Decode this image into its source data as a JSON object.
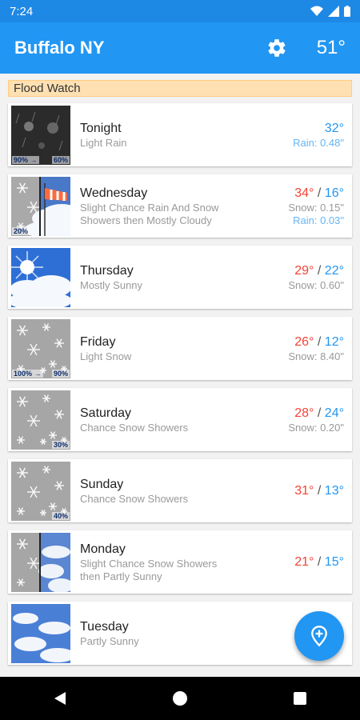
{
  "status_bar": {
    "time": "7:24"
  },
  "app_bar": {
    "title": "Buffalo NY",
    "current_temp": "51°",
    "settings_icon": "gear-icon"
  },
  "alert": {
    "label": "Flood Watch"
  },
  "forecast": [
    {
      "day": "Tonight",
      "desc": "Light Rain",
      "desc2": "",
      "hi": "",
      "lo": "32°",
      "precip1": "Rain: 0.48\"",
      "precip1_type": "rain",
      "precip2": "",
      "precip2_type": "",
      "pct_left": "90%",
      "pct_arrow": "→",
      "pct_right": "60%",
      "image": "night-rain"
    },
    {
      "day": "Wednesday",
      "desc": "Slight Chance Rain And Snow",
      "desc2": "Showers then Mostly Cloudy",
      "hi": "34°",
      "lo": "16°",
      "precip1": "Snow: 0.15\"",
      "precip1_type": "snow",
      "precip2": "Rain: 0.03\"",
      "precip2_type": "rain",
      "pct_left": "20%",
      "pct_arrow": "",
      "pct_right": "",
      "image": "snow-windy"
    },
    {
      "day": "Thursday",
      "desc": "Mostly Sunny",
      "desc2": "",
      "hi": "29°",
      "lo": "22°",
      "precip1": "Snow: 0.60\"",
      "precip1_type": "snow",
      "precip2": "",
      "precip2_type": "",
      "pct_left": "",
      "pct_arrow": "",
      "pct_right": "",
      "image": "sunny"
    },
    {
      "day": "Friday",
      "desc": "Light Snow",
      "desc2": "",
      "hi": "26°",
      "lo": "12°",
      "precip1": "Snow: 8.40\"",
      "precip1_type": "snow",
      "precip2": "",
      "precip2_type": "",
      "pct_left": "100%",
      "pct_arrow": "→",
      "pct_right": "90%",
      "image": "snow"
    },
    {
      "day": "Saturday",
      "desc": "Chance Snow Showers",
      "desc2": "",
      "hi": "28°",
      "lo": "24°",
      "precip1": "Snow: 0.20\"",
      "precip1_type": "snow",
      "precip2": "",
      "precip2_type": "",
      "pct_left": "",
      "pct_arrow": "",
      "pct_right": "30%",
      "image": "snow"
    },
    {
      "day": "Sunday",
      "desc": "Chance Snow Showers",
      "desc2": "",
      "hi": "31°",
      "lo": "13°",
      "precip1": "",
      "precip1_type": "",
      "precip2": "",
      "precip2_type": "",
      "pct_left": "",
      "pct_arrow": "",
      "pct_right": "40%",
      "image": "snow"
    },
    {
      "day": "Monday",
      "desc": "Slight Chance Snow Showers",
      "desc2": "then Partly Sunny",
      "hi": "21°",
      "lo": "15°",
      "precip1": "",
      "precip1_type": "",
      "precip2": "",
      "precip2_type": "",
      "pct_left": "",
      "pct_arrow": "",
      "pct_right": "",
      "image": "snow-clouds"
    },
    {
      "day": "Tuesday",
      "desc": "Partly Sunny",
      "desc2": "",
      "hi": "",
      "lo": "",
      "precip1": "",
      "precip1_type": "",
      "precip2": "",
      "precip2_type": "",
      "pct_left": "",
      "pct_arrow": "",
      "pct_right": "",
      "image": "clouds"
    }
  ],
  "fab": {
    "icon": "location-pin-add-icon"
  },
  "nav_bar": {
    "back_icon": "back-icon",
    "home_icon": "home-icon",
    "recents_icon": "recents-icon"
  },
  "colors": {
    "primary": "#2196f3",
    "status_bar": "#1e88e5",
    "high_temp": "#f44336",
    "low_temp": "#2196f3",
    "alert_bg": "#ffe0b2"
  }
}
